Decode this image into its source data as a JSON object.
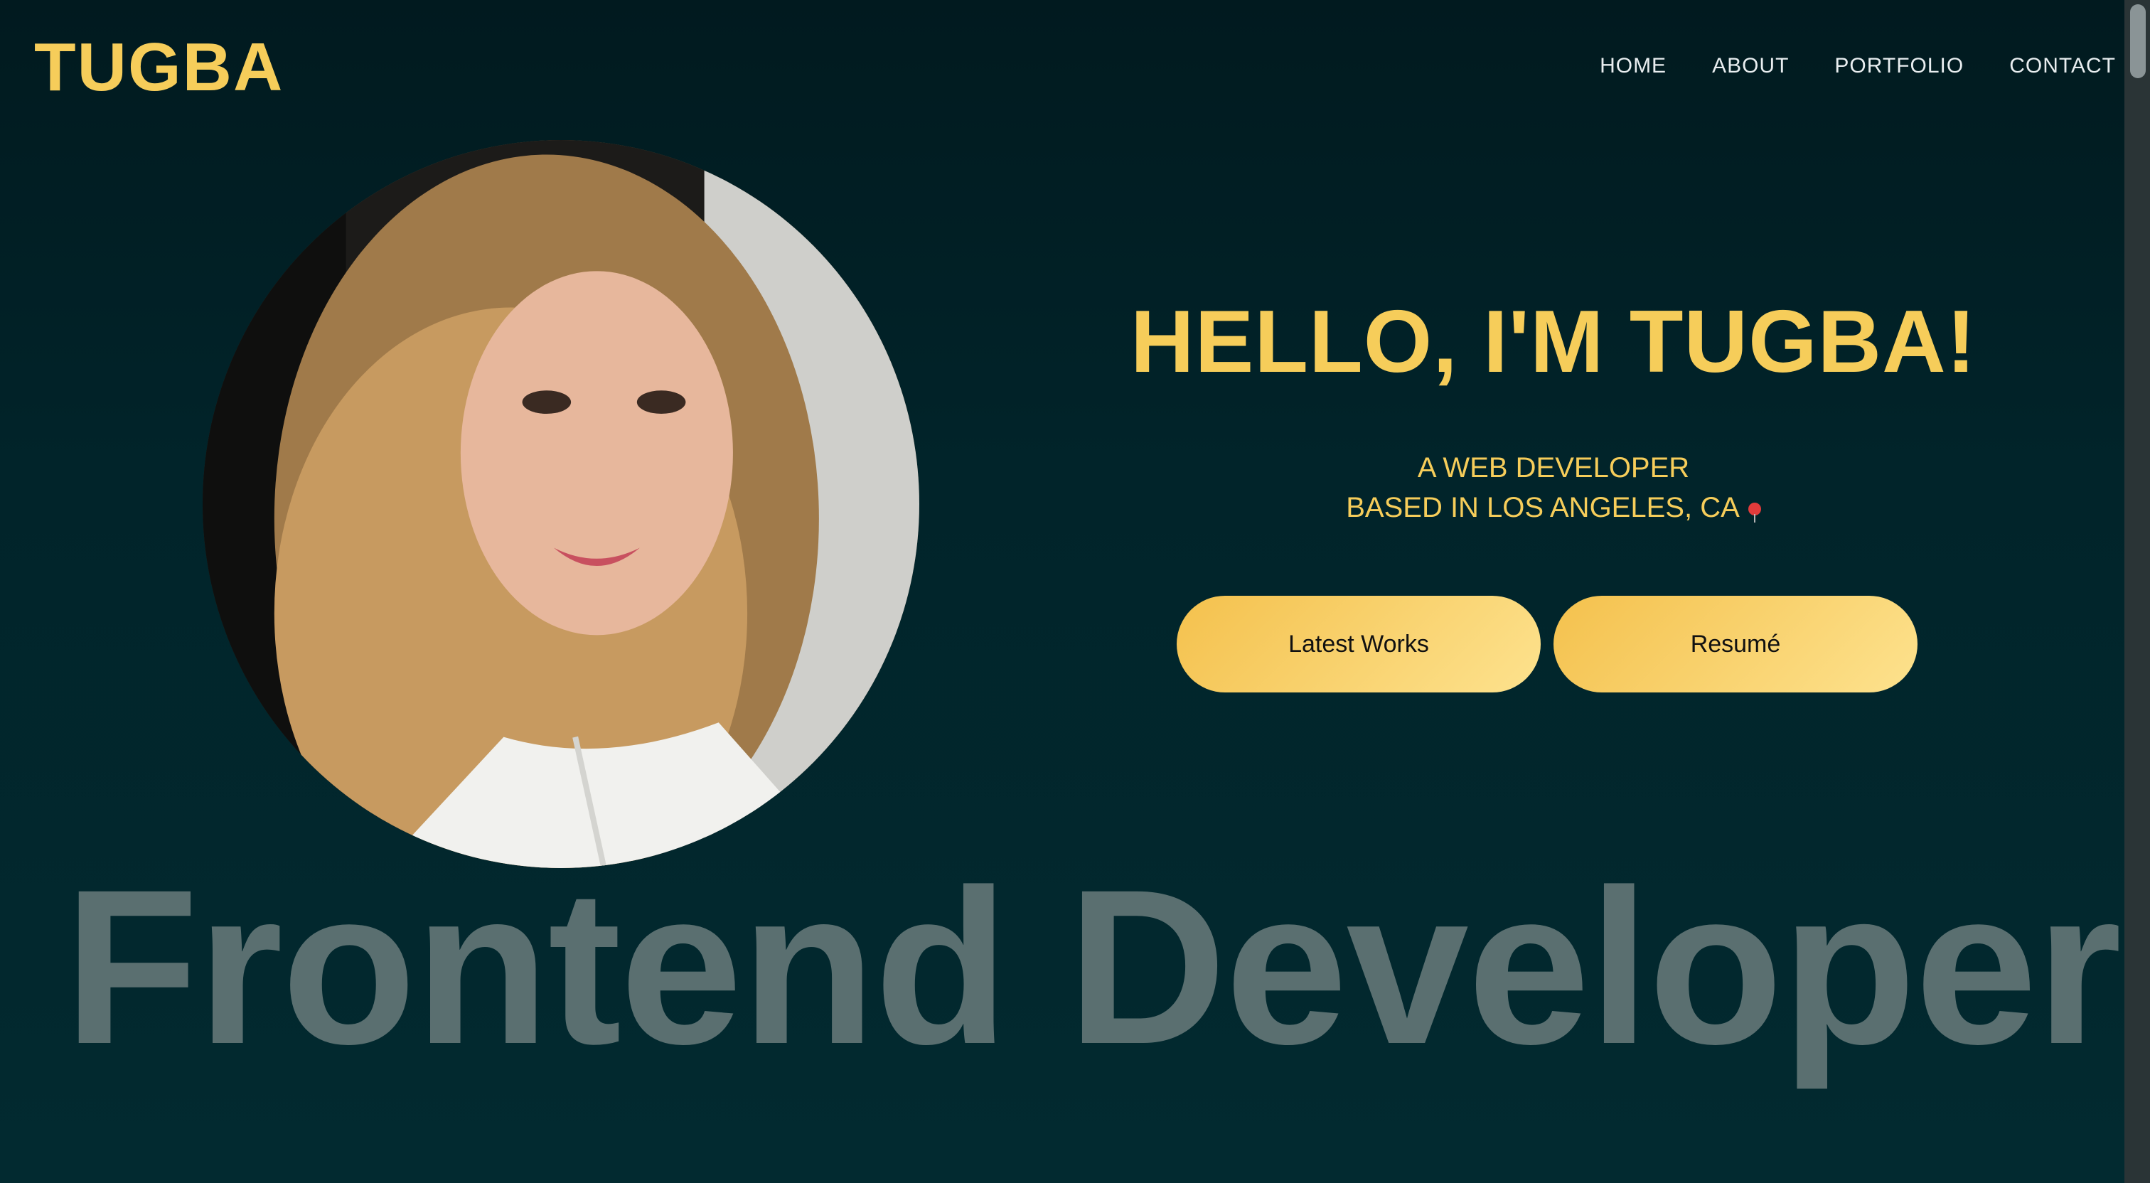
{
  "header": {
    "logo": "TUGBA",
    "nav": [
      "HOME",
      "ABOUT",
      "PORTFOLIO",
      "CONTACT"
    ]
  },
  "hero": {
    "title": "HELLO, I'M TUGBA!",
    "subtitle_line1": "A WEB DEVELOPER",
    "subtitle_line2": "BASED IN LOS ANGELES, CA",
    "buttons": {
      "latest_works": "Latest Works",
      "resume": "Resumé"
    },
    "background_text": "Frontend Developer"
  },
  "colors": {
    "accent": "#f6cd5a",
    "background": "#01242a",
    "muted_text": "#5a6f70"
  },
  "icons": {
    "location": "map-pin-icon"
  }
}
